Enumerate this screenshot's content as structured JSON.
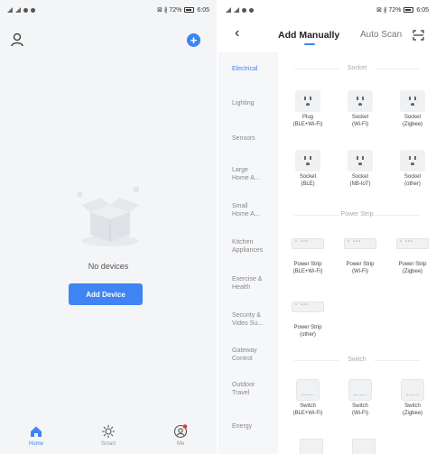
{
  "left": {
    "status": {
      "left": "▯ᵃᵃ.ıl .ıl ⚡ ◎ ⊥ ●",
      "right": "⊠ ∦ 72%",
      "time": "6:05"
    },
    "empty_text": "No devices",
    "add_button": "Add Device",
    "tabs": [
      {
        "label": "Home",
        "icon": "home-icon"
      },
      {
        "label": "Smart",
        "icon": "sun-icon"
      },
      {
        "label": "Me",
        "icon": "profile-icon"
      }
    ]
  },
  "right": {
    "status": {
      "left": "▯ᵃᵃ.ıl .ıl ⚡ ◎ ⊥ ●",
      "right": "⊠ ∦ 72%",
      "time": "6:05"
    },
    "nav": {
      "back": "‹",
      "manual": "Add Manually",
      "auto": "Auto Scan"
    },
    "categories": [
      "Electrical",
      "Lighting",
      "Sensors",
      "Large\nHome A...",
      "Small\nHome A...",
      "Kitchen\nAppliances",
      "Exercise &\nHealth",
      "Security &\nVideo Su...",
      "Gateway\nControl",
      "Outdoor\nTravel",
      "Energy"
    ],
    "sections": {
      "socket": "Socket",
      "strip": "Power Strip",
      "switch": "Switch"
    },
    "socket_items": [
      "Plug\n(BLE+Wi-Fi)",
      "Socket\n(Wi-Fi)",
      "Socket\n(Zigbee)",
      "Socket\n(BLE)",
      "Socket\n(NB-IoT)",
      "Socket\n(other)"
    ],
    "strip_items": [
      "Power Strip\n(BLE+Wi-Fi)",
      "Power Strip\n(Wi-Fi)",
      "Power Strip\n(Zigbee)",
      "Power Strip\n(other)"
    ],
    "switch_items": [
      "Switch\n(BLE+Wi-Fi)",
      "Switch\n(Wi-Fi)",
      "Switch\n(Zigbee)"
    ]
  },
  "colors": {
    "accent": "#3f84f2",
    "badge": "#e53935"
  }
}
